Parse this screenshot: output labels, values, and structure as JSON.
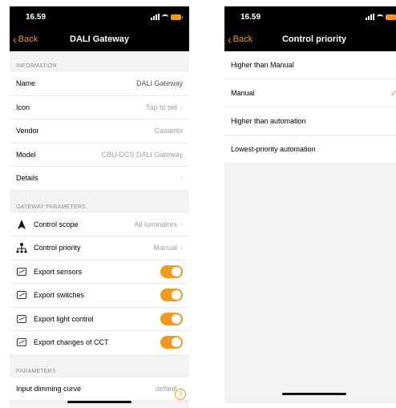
{
  "colors": {
    "accent": "#f39a1e",
    "nav_bg": "#000000",
    "group_bg": "#f2f2f2",
    "secondary_text": "#a0a0a6"
  },
  "left": {
    "status": {
      "time": "16.59"
    },
    "nav": {
      "back_label": "Back",
      "title": "DALI Gateway"
    },
    "information": {
      "header": "INFORMATION",
      "rows": [
        {
          "label": "Name",
          "value": "DALI Gateway"
        },
        {
          "label": "Icon",
          "value": "Tap to set"
        },
        {
          "label": "Vendor",
          "value": "Casambi"
        },
        {
          "label": "Model",
          "value": "CBU-DCS DALI Gateway"
        },
        {
          "label": "Details",
          "value": ""
        }
      ]
    },
    "gateway": {
      "header": "GATEWAY PARAMETERS",
      "control_scope": {
        "label": "Control scope",
        "value": "All luminaires",
        "icon": "navigation-arrow-icon"
      },
      "control_priority": {
        "label": "Control priority",
        "value": "Manual",
        "icon": "hierarchy-icon"
      },
      "toggles": [
        {
          "label": "Export sensors",
          "on": true,
          "icon": "graph-box-icon"
        },
        {
          "label": "Export switches",
          "on": true,
          "icon": "graph-box-icon"
        },
        {
          "label": "Export light control",
          "on": true,
          "icon": "graph-box-icon"
        },
        {
          "label": "Export changes of CCT",
          "on": true,
          "icon": "graph-box-icon"
        }
      ]
    },
    "parameters": {
      "header": "PARAMETERS",
      "rows": [
        {
          "label": "Input dimming curve",
          "value": "default"
        }
      ]
    }
  },
  "right": {
    "status": {
      "time": "16.59"
    },
    "nav": {
      "back_label": "Back",
      "title": "Control priority"
    },
    "options": [
      {
        "label": "Higher than Manual",
        "selected": false
      },
      {
        "label": "Manual",
        "selected": true
      },
      {
        "label": "Higher than automation",
        "selected": false
      },
      {
        "label": "Lowest-priority automation",
        "selected": false
      }
    ]
  }
}
